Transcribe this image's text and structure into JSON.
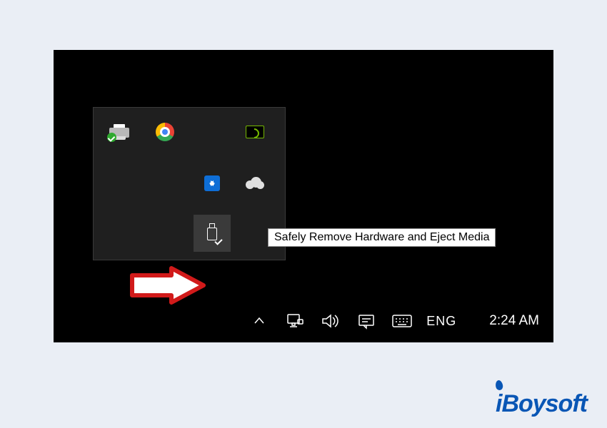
{
  "tooltip": {
    "text": "Safely Remove Hardware and Eject Media"
  },
  "tray": {
    "items": [
      {
        "name": "printer-icon"
      },
      {
        "name": "chrome-icon"
      },
      {
        "name": "nvidia-icon"
      },
      {
        "name": "teamviewer-icon"
      },
      {
        "name": "cloud-sync-icon"
      },
      {
        "name": "usb-eject-icon"
      }
    ]
  },
  "taskbar": {
    "language": "ENG",
    "time": "2:24 AM",
    "icons": [
      {
        "name": "overflow-chevron-icon"
      },
      {
        "name": "network-icon"
      },
      {
        "name": "volume-icon"
      },
      {
        "name": "action-center-icon"
      },
      {
        "name": "touch-keyboard-icon"
      }
    ]
  },
  "watermark": {
    "text": "iBoysoft"
  }
}
